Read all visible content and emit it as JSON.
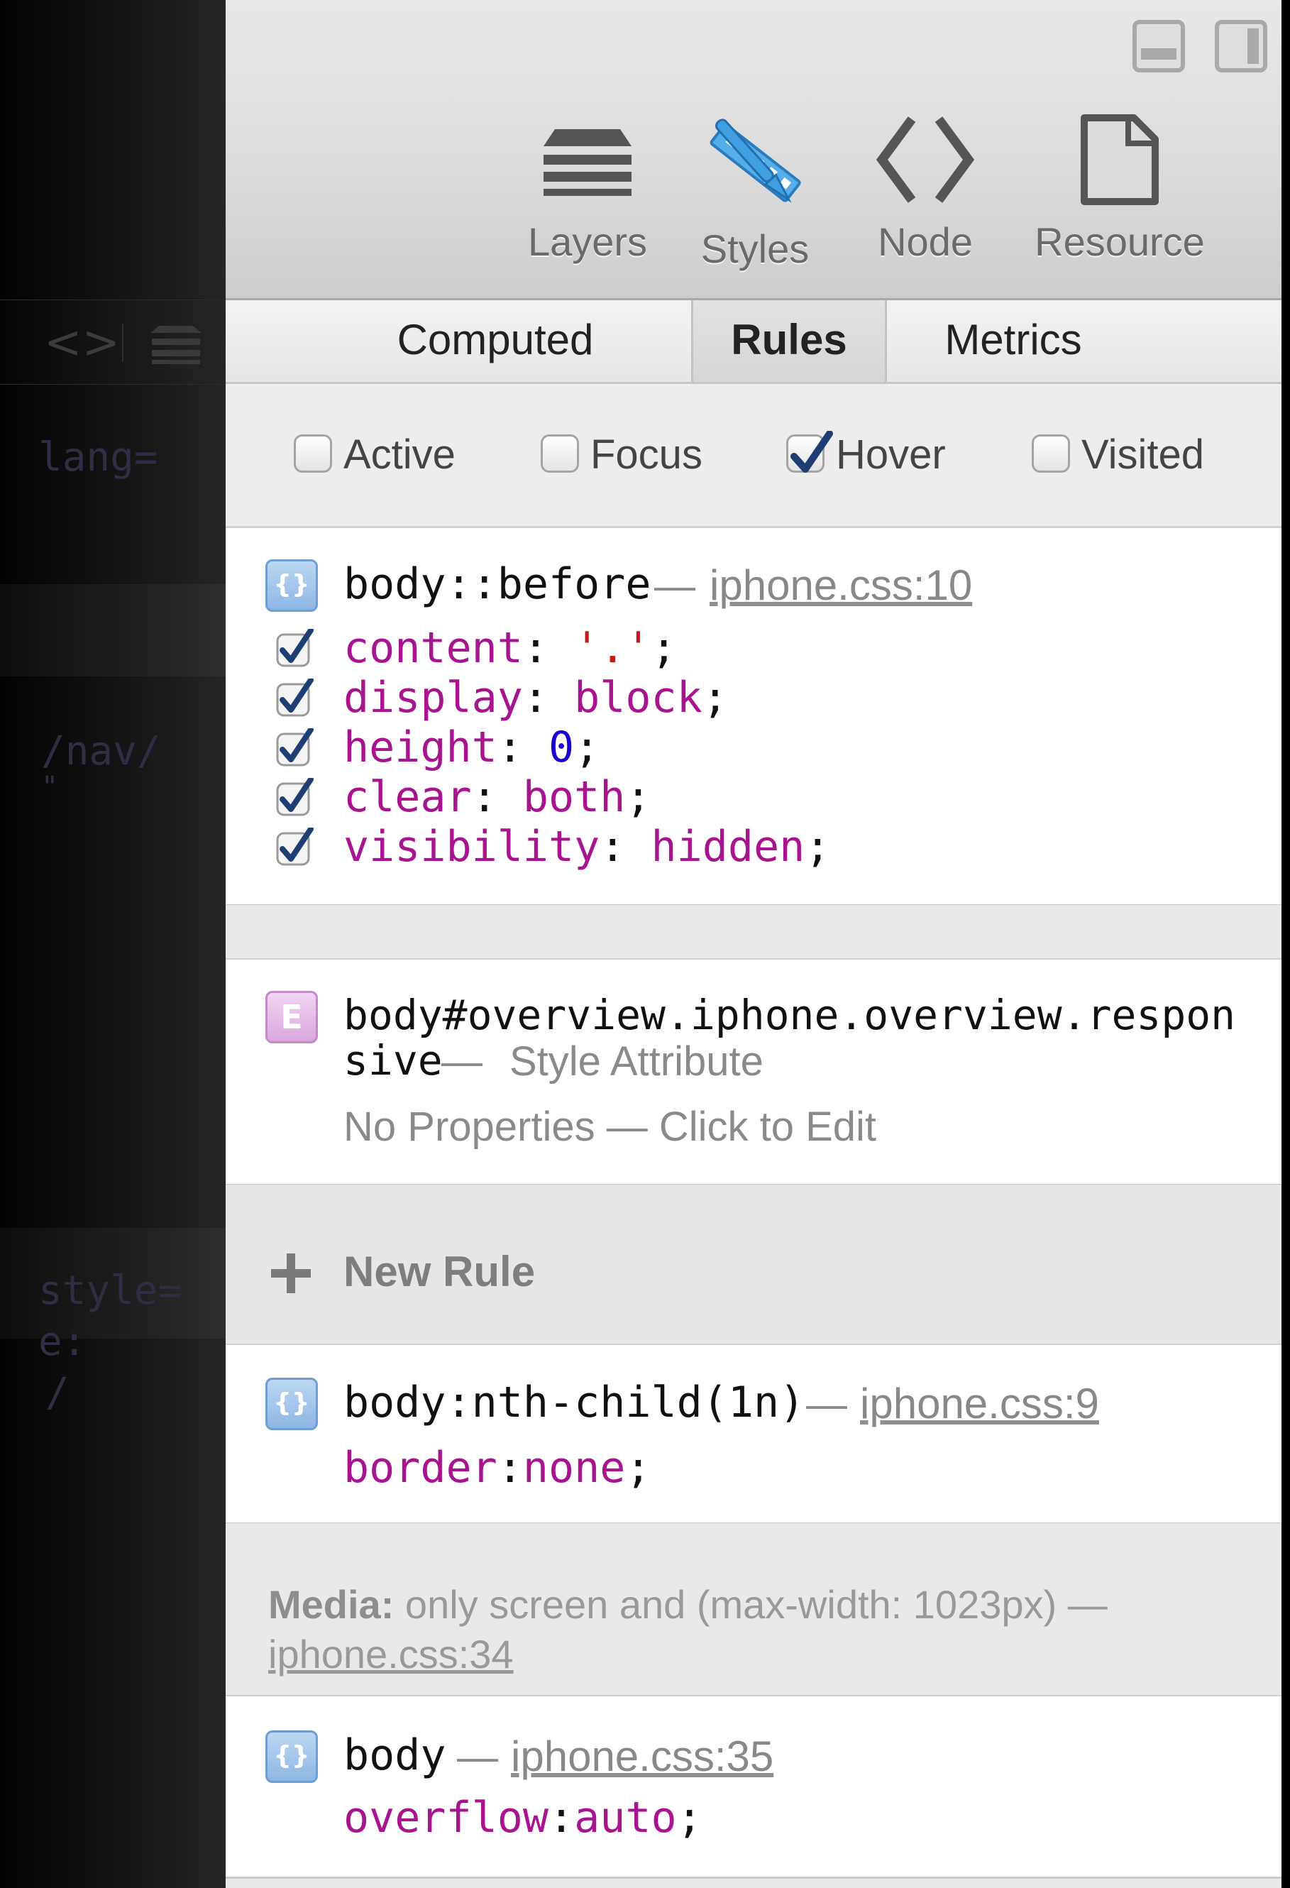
{
  "left_pane": {
    "code_fragments": [
      "lang=",
      "/nav/",
      "\"",
      "style=",
      "e:",
      "/"
    ]
  },
  "window_controls": {
    "dock_bottom": "dock-bottom-icon",
    "dock_side": "dock-side-icon"
  },
  "toolbar": {
    "items": [
      {
        "label": "Layers",
        "icon": "layers-icon"
      },
      {
        "label": "Styles",
        "icon": "styles-icon",
        "selected": true
      },
      {
        "label": "Node",
        "icon": "node-icon"
      },
      {
        "label": "Resource",
        "icon": "resource-icon"
      }
    ]
  },
  "tabs": [
    {
      "label": "Computed"
    },
    {
      "label": "Rules",
      "active": true
    },
    {
      "label": "Metrics"
    }
  ],
  "pseudo_classes": [
    {
      "label": "Active",
      "checked": false
    },
    {
      "label": "Focus",
      "checked": false
    },
    {
      "label": "Hover",
      "checked": true
    },
    {
      "label": "Visited",
      "checked": false
    }
  ],
  "rules": [
    {
      "selector": "body::before",
      "separator": "—",
      "source": "iphone.css:10",
      "properties": [
        {
          "name": "content",
          "value": "'.'",
          "value_type": "string"
        },
        {
          "name": "display",
          "value": "block",
          "value_type": "keyword"
        },
        {
          "name": "height",
          "value": "0",
          "value_type": "number"
        },
        {
          "name": "clear",
          "value": "both",
          "value_type": "keyword"
        },
        {
          "name": "visibility",
          "value": "hidden",
          "value_type": "keyword"
        }
      ]
    },
    {
      "selector_line1": "body#overview.iphone.overview.respon",
      "selector_line2": "sive",
      "separator": "—",
      "source": "Style Attribute",
      "empty_text": "No Properties — Click to Edit"
    },
    {
      "selector": "body:nth-child(1n)",
      "separator": "—",
      "source": "iphone.css:9",
      "property": {
        "name": "border",
        "value": "none"
      }
    },
    {
      "selector": "body",
      "separator": "—",
      "source": "iphone.css:35",
      "property": {
        "name": "overflow",
        "value": "auto"
      }
    }
  ],
  "new_rule": {
    "label": "New Rule"
  },
  "media": {
    "prefix": "Media:",
    "query": " only screen and (max-width: 1023px) —",
    "source": "iphone.css:34"
  },
  "colors": {
    "property_name": "#a8148f",
    "string_value": "#c41a16",
    "number_value": "#1c00cf",
    "checkbox_check": "#1e3f73",
    "styles_icon": "#3f9fe0"
  }
}
